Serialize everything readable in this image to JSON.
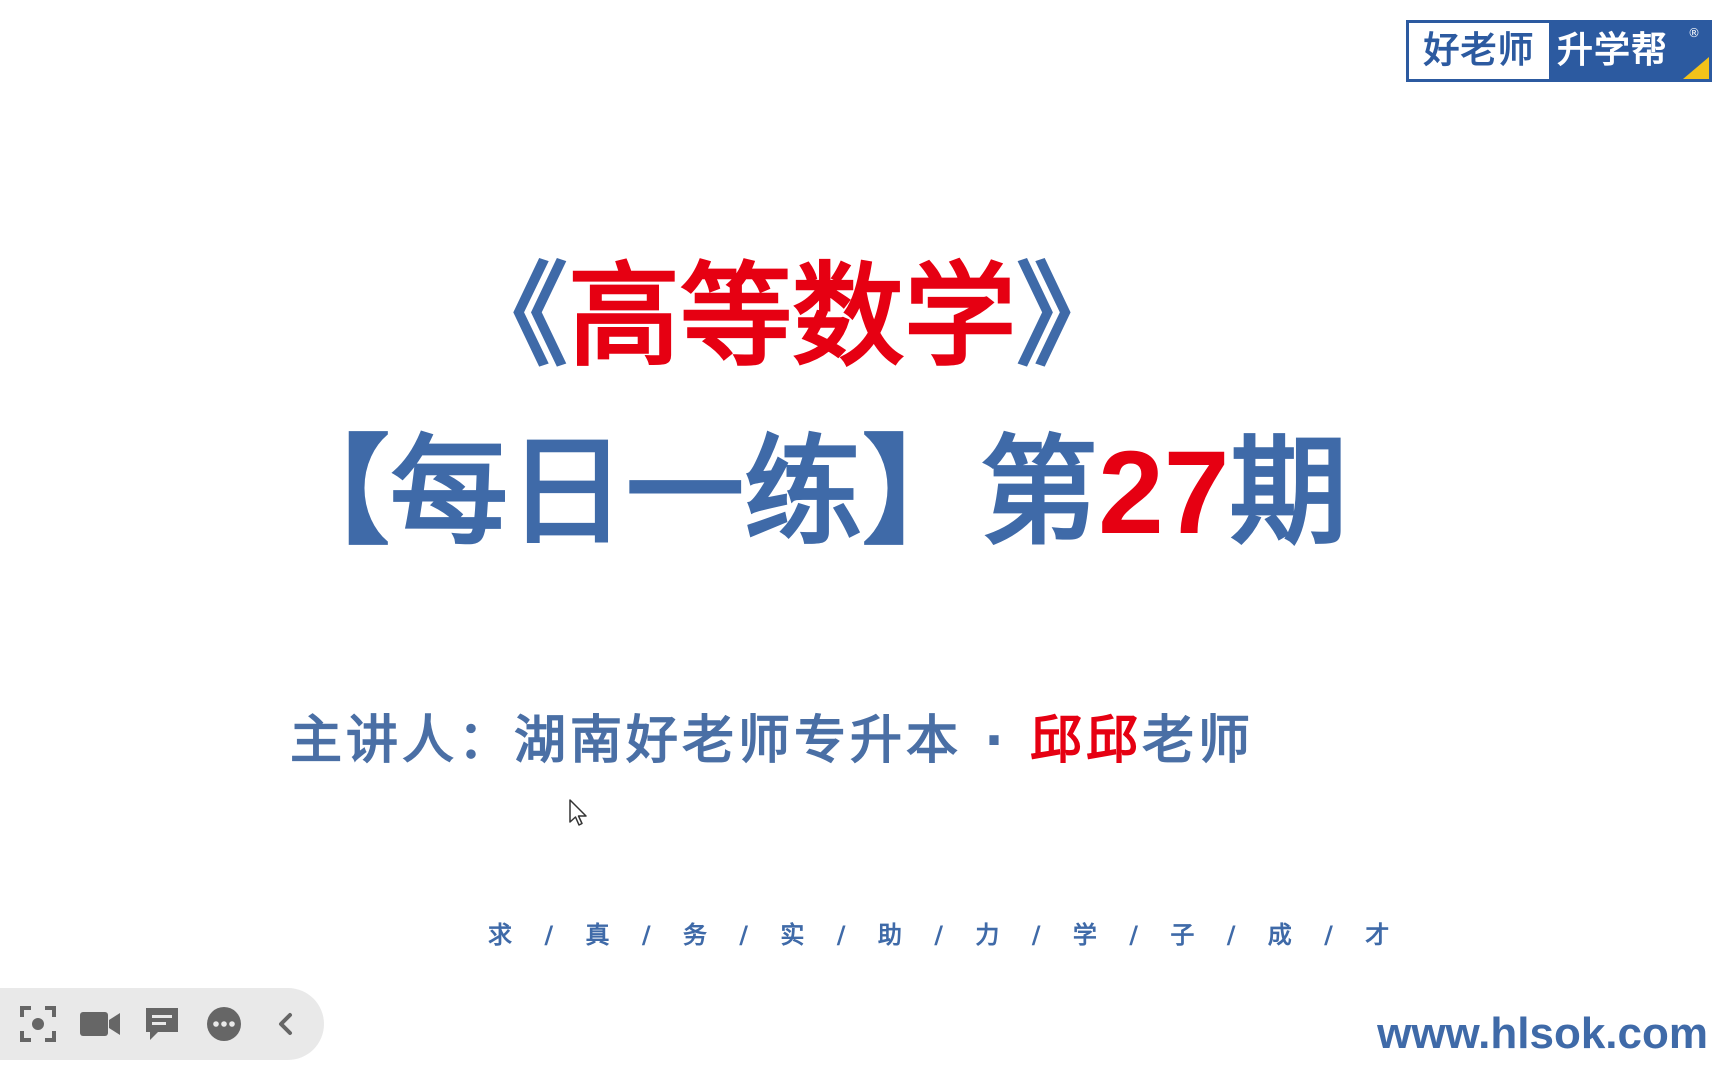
{
  "logo": {
    "left_text": "好老师",
    "right_text": "升学帮",
    "registered_mark": "®"
  },
  "title": {
    "open_quote": "《",
    "course": "高等数学",
    "close_quote": "》",
    "open_bracket": "【",
    "series": "每日一练",
    "close_bracket": "】",
    "issue_prefix": "第",
    "issue_number": "27",
    "issue_suffix": "期"
  },
  "presenter": {
    "label": "主讲人：湖南好老师专升本 · ",
    "teacher_name": "邱邱",
    "title": "老师"
  },
  "motto": "求 / 真 / 务 / 实 / 助 / 力 / 学 / 子 / 成 / 才",
  "website": "www.hlsok.com",
  "colors": {
    "brand_blue": "#3f6aa8",
    "accent_red": "#e60012",
    "logo_blue": "#2c5aa0",
    "logo_yellow": "#f3c21a",
    "toolbar_bg": "#e9e9e9"
  },
  "toolbar": {
    "buttons": [
      {
        "icon": "screenshot-icon"
      },
      {
        "icon": "video-camera-icon"
      },
      {
        "icon": "comment-icon"
      },
      {
        "icon": "more-icon"
      },
      {
        "icon": "chevron-left-icon"
      }
    ]
  }
}
